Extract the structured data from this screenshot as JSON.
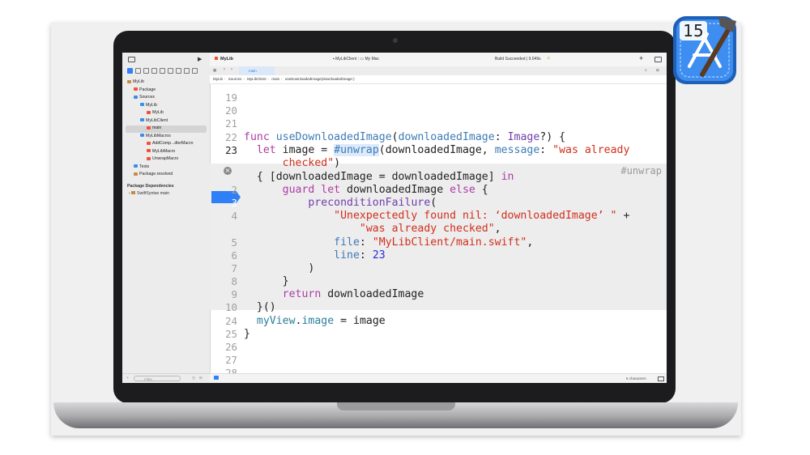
{
  "toolbar": {
    "project": "MyLib",
    "scheme": "MyLibClient",
    "destination": "My Mac",
    "build_status": "Build Succeeded | 9.049s",
    "add": "+"
  },
  "tabs": [
    {
      "label": "main"
    }
  ],
  "jumpbar": [
    "MyLib",
    "Sources",
    "MyLibClient",
    "main",
    "useDownloadedImage(downloadedImage:)"
  ],
  "sidebar": {
    "items": [
      {
        "label": "MyLib",
        "indent": 0,
        "icon": "package-icon"
      },
      {
        "label": "Package",
        "indent": 1,
        "icon": "swift-icon"
      },
      {
        "label": "Sources",
        "indent": 1,
        "icon": "folder-icon"
      },
      {
        "label": "MyLib",
        "indent": 2,
        "icon": "folder-icon"
      },
      {
        "label": "MyLib",
        "indent": 3,
        "icon": "swift-icon"
      },
      {
        "label": "MyLibClient",
        "indent": 2,
        "icon": "folder-icon"
      },
      {
        "label": "main",
        "indent": 3,
        "icon": "swift-icon"
      },
      {
        "label": "MyLibMacros",
        "indent": 2,
        "icon": "folder-icon"
      },
      {
        "label": "AddComp...dlerMacro",
        "indent": 3,
        "icon": "swift-icon"
      },
      {
        "label": "MyLibMacro",
        "indent": 3,
        "icon": "swift-icon"
      },
      {
        "label": "UnwrapMacro",
        "indent": 3,
        "icon": "swift-icon"
      },
      {
        "label": "Tests",
        "indent": 1,
        "icon": "folder-icon"
      },
      {
        "label": "Package.resolved",
        "indent": 1,
        "icon": "package-icon"
      }
    ],
    "section_header": "Package Dependencies",
    "dependency": "SwiftSyntax main",
    "filter_placeholder": "Filter"
  },
  "editor": {
    "gutter": {
      "outer_top": [
        "19",
        "20",
        "21",
        "22",
        "23"
      ],
      "expansion": [
        "",
        "2",
        "3",
        "4",
        "",
        "5",
        "6",
        "7",
        "8",
        "9",
        "10"
      ],
      "outer_bottom": [
        "24",
        "25",
        "26",
        "27",
        "28"
      ]
    },
    "expansion_tag": "#unwrap",
    "status": "6 characters"
  },
  "badge": {
    "version": "15"
  },
  "colors": {
    "accent": "#2f7ff6",
    "keyword": "#ad3da4",
    "string": "#d12f1b",
    "number": "#272ad8"
  }
}
